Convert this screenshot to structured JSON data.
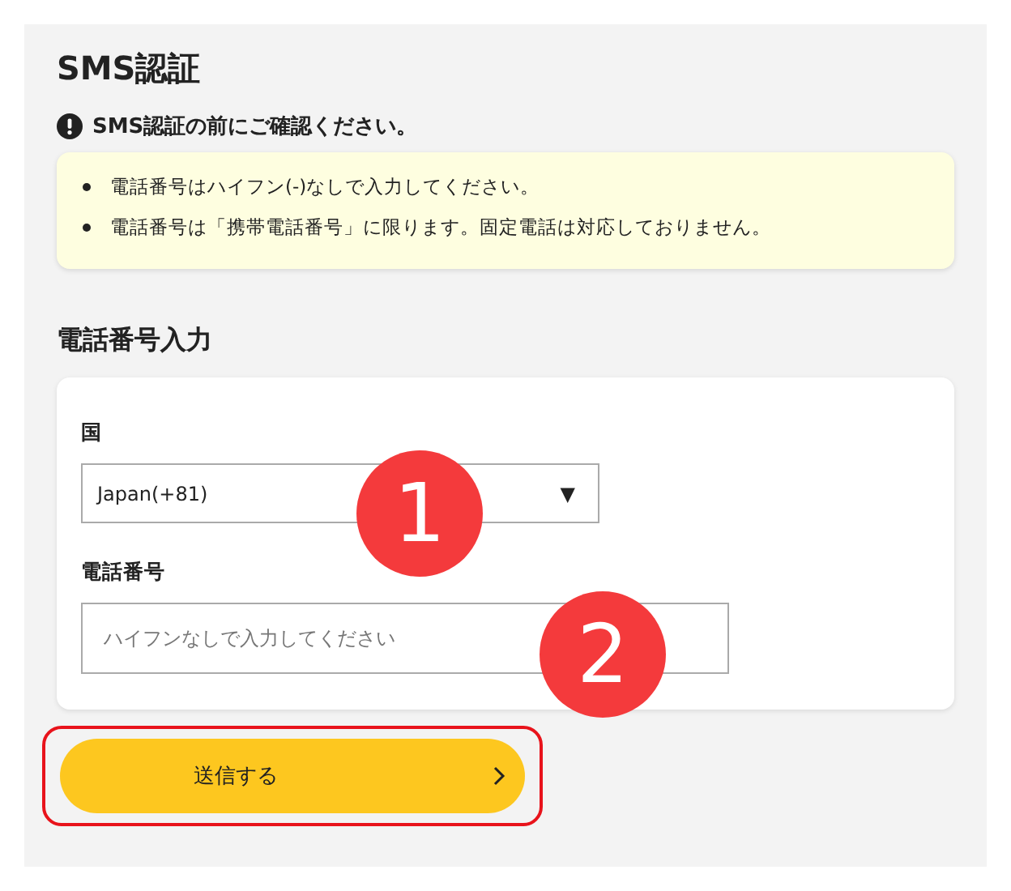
{
  "title": "SMS認証",
  "notice": {
    "heading": "SMS認証の前にご確認ください。",
    "items": [
      "電話番号はハイフン(-)なしで入力してください。",
      "電話番号は「携帯電話番号」に限ります。固定電話は対応しておりません。"
    ]
  },
  "section_title": "電話番号入力",
  "form": {
    "country": {
      "label": "国",
      "value": "Japan(+81)",
      "arrow": "▼"
    },
    "phone": {
      "label": "電話番号",
      "placeholder": "ハイフンなしで入力してください"
    }
  },
  "submit": {
    "label": "送信する",
    "highlighted": true
  },
  "callouts": [
    "1",
    "2"
  ]
}
